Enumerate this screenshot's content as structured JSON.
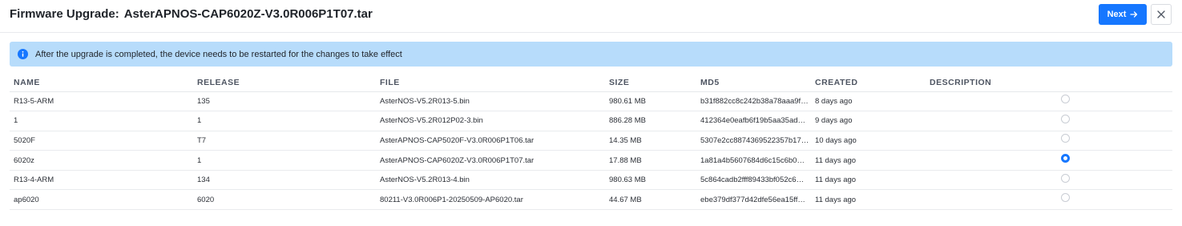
{
  "header": {
    "title_prefix": "Firmware Upgrade:",
    "title_file": "AsterAPNOS-CAP6020Z-V3.0R006P1T07.tar",
    "next_label": "Next"
  },
  "alert": {
    "text": "After the upgrade is completed, the device needs to be restarted for the changes to take effect"
  },
  "table": {
    "columns": [
      "NAME",
      "RELEASE",
      "FILE",
      "SIZE",
      "MD5",
      "CREATED",
      "DESCRIPTION",
      ""
    ],
    "rows": [
      {
        "name": "R13-5-ARM",
        "release": "135",
        "file": "AsterNOS-V5.2R013-5.bin",
        "size": "980.61 MB",
        "md5": "b31f882cc8c242b38a78aaa9f…",
        "created": "8 days ago",
        "description": "",
        "selected": false
      },
      {
        "name": "1",
        "release": "1",
        "file": "AsterNOS-V5.2R012P02-3.bin",
        "size": "886.28 MB",
        "md5": "412364e0eafb6f19b5aa35ad…",
        "created": "9 days ago",
        "description": "",
        "selected": false
      },
      {
        "name": "5020F",
        "release": "T7",
        "file": "AsterAPNOS-CAP5020F-V3.0R006P1T06.tar",
        "size": "14.35 MB",
        "md5": "5307e2cc8874369522357b17…",
        "created": "10 days ago",
        "description": "",
        "selected": false
      },
      {
        "name": "6020z",
        "release": "1",
        "file": "AsterAPNOS-CAP6020Z-V3.0R006P1T07.tar",
        "size": "17.88 MB",
        "md5": "1a81a4b5607684d6c15c6b0…",
        "created": "11 days ago",
        "description": "",
        "selected": true
      },
      {
        "name": "R13-4-ARM",
        "release": "134",
        "file": "AsterNOS-V5.2R013-4.bin",
        "size": "980.63 MB",
        "md5": "5c864cadb2fff89433bf052c6…",
        "created": "11 days ago",
        "description": "",
        "selected": false
      },
      {
        "name": "ap6020",
        "release": "6020",
        "file": "80211-V3.0R006P1-20250509-AP6020.tar",
        "size": "44.67 MB",
        "md5": "ebe379df377d42dfe56ea15ff…",
        "created": "11 days ago",
        "description": "",
        "selected": false
      }
    ]
  },
  "colors": {
    "primary": "#1677ff",
    "alert_bg": "#b7dcfb",
    "info_icon": "#1677ff"
  },
  "icons": {
    "next": "arrow-right-icon",
    "close": "close-icon",
    "alert": "info-icon"
  }
}
